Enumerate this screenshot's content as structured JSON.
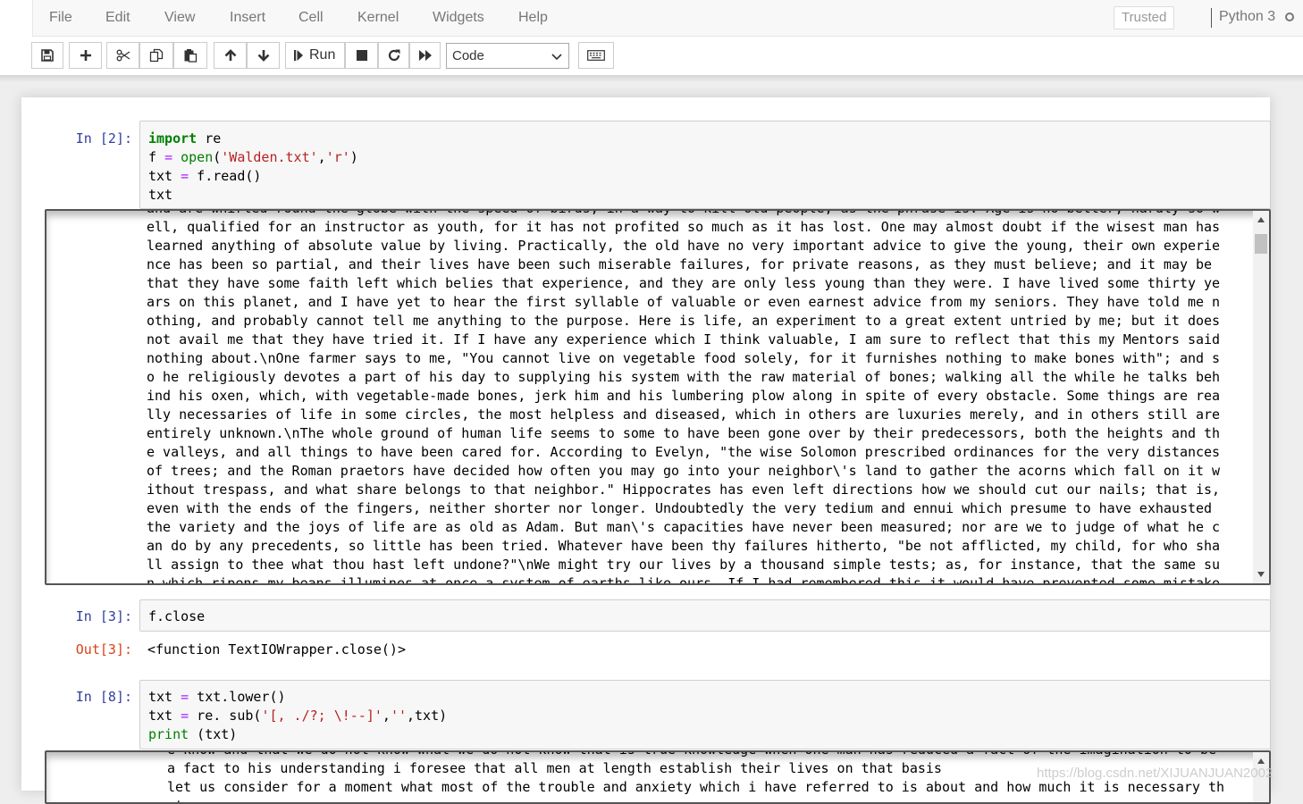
{
  "menubar": {
    "items": [
      "File",
      "Edit",
      "View",
      "Insert",
      "Cell",
      "Kernel",
      "Widgets",
      "Help"
    ],
    "trusted": "Trusted",
    "kernel_name": "Python 3"
  },
  "toolbar": {
    "run_label": "Run",
    "cell_type": "Code",
    "icons": [
      "save-icon",
      "plus-icon",
      "scissors-icon",
      "copy-icon",
      "paste-icon",
      "arrow-up-icon",
      "arrow-down-icon",
      "step-forward-icon",
      "stop-icon",
      "refresh-icon",
      "fast-forward-icon",
      "keyboard-icon"
    ]
  },
  "cells": [
    {
      "prompt": "In  [2]:",
      "code": [
        [
          {
            "t": "import",
            "c": "kw"
          },
          {
            "t": " re",
            "c": ""
          }
        ],
        [
          {
            "t": "f ",
            "c": ""
          },
          {
            "t": "=",
            "c": "op"
          },
          {
            "t": " ",
            "c": ""
          },
          {
            "t": "open",
            "c": "bi"
          },
          {
            "t": "(",
            "c": ""
          },
          {
            "t": "'Walden.txt'",
            "c": "str"
          },
          {
            "t": ",",
            "c": ""
          },
          {
            "t": "'r'",
            "c": "str"
          },
          {
            "t": ")",
            "c": ""
          }
        ],
        [
          {
            "t": "txt ",
            "c": ""
          },
          {
            "t": "=",
            "c": "op"
          },
          {
            "t": " f.read()",
            "c": ""
          }
        ],
        [
          {
            "t": "txt",
            "c": ""
          }
        ]
      ],
      "output": "and are whirled round the globe with the speed of birds, in a way to kill old people, as the phrase is. Age is no better, hardly so well, qualified for an instructor as youth, for it has not profited so much as it has lost. One may almost doubt if the wisest man has learned anything of absolute value by living. Practically, the old have no very important advice to give the young, their own experience has been so partial, and their lives have been such miserable failures, for private reasons, as they must believe; and it may be that they have some faith left which belies that experience, and they are only less young than they were. I have lived some thirty years on this planet, and I have yet to hear the first syllable of valuable or even earnest advice from my seniors. They have told me nothing, and probably cannot tell me anything to the purpose. Here is life, an experiment to a great extent untried by me; but it does not avail me that they have tried it. If I have any experience which I think valuable, I am sure to reflect that this my Mentors said nothing about.\\nOne farmer says to me, \"You cannot live on vegetable food solely, for it furnishes nothing to make bones with\"; and so he religiously devotes a part of his day to supplying his system with the raw material of bones; walking all the while he talks behind his oxen, which, with vegetable-made bones, jerk him and his lumbering plow along in spite of every obstacle. Some things are really necessaries of life in some circles, the most helpless and diseased, which in others are luxuries merely, and in others still are entirely unknown.\\nThe whole ground of human life seems to some to have been gone over by their predecessors, both the heights and the valleys, and all things to have been cared for. According to Evelyn, \"the wise Solomon prescribed ordinances for the very distances of trees; and the Roman praetors have decided how often you may go into your neighbor\\'s land to gather the acorns which fall on it without trespass, and what share belongs to that neighbor.\" Hippocrates has even left directions how we should cut our nails; that is, even with the ends of the fingers, neither shorter nor longer. Undoubtedly the very tedium and ennui which presume to have exhausted the variety and the joys of life are as old as Adam. But man\\'s capacities have never been measured; nor are we to judge of what he can do by any precedents, so little has been tried. Whatever have been thy failures hitherto, \"be not afflicted, my child, for who shall assign to thee what thou hast left undone?\"\\nWe might try our lives by a thousand simple tests; as, for instance, that the same sun which ripens my beans illumines at once a system of earths like ours. If I had remembered this it would have prevented some mistakes. This was not t"
    },
    {
      "prompt": "In  [3]:",
      "code": [
        [
          {
            "t": "f.close",
            "c": ""
          }
        ]
      ],
      "out_prompt": "Out[3]:",
      "output": "<function TextIOWrapper.close()>"
    },
    {
      "prompt": "In  [8]:",
      "code": [
        [
          {
            "t": "txt ",
            "c": ""
          },
          {
            "t": "=",
            "c": "op"
          },
          {
            "t": " txt.lower()",
            "c": ""
          }
        ],
        [
          {
            "t": "txt ",
            "c": ""
          },
          {
            "t": "=",
            "c": "op"
          },
          {
            "t": " re. sub(",
            "c": ""
          },
          {
            "t": "'[, ./?; \\!--]'",
            "c": "str"
          },
          {
            "t": ",",
            "c": ""
          },
          {
            "t": "''",
            "c": "str"
          },
          {
            "t": ",txt)",
            "c": ""
          }
        ],
        [
          {
            "t": "print",
            "c": "bi"
          },
          {
            "t": " (txt)",
            "c": ""
          }
        ]
      ],
      "output": "e know and that we do not know what we do not know that is true knowledge when one man has reduced a fact of the imagination to be a fact to his understanding i foresee that all men at length establish their lives on that basis\nlet us consider for a moment what most of the trouble and anxiety which i have referred to is about and how much it is necessary that"
    }
  ],
  "watermark": "https://blog.csdn.net/XIJUANJUAN2002"
}
